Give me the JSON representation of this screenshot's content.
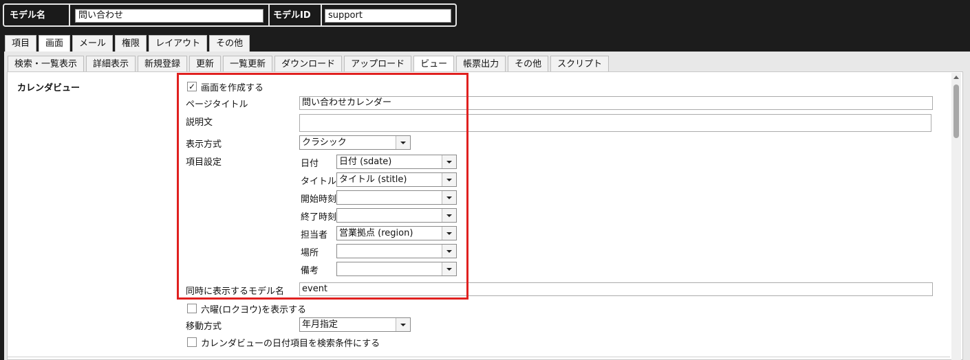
{
  "header": {
    "model_name_label": "モデル名",
    "model_name_value": "問い合わせ",
    "model_id_label": "モデルID",
    "model_id_value": "support"
  },
  "main_tabs": [
    "項目",
    "画面",
    "メール",
    "権限",
    "レイアウト",
    "その他"
  ],
  "sub_tabs": [
    "検索・一覧表示",
    "詳細表示",
    "新規登録",
    "更新",
    "一覧更新",
    "ダウンロード",
    "アップロード",
    "ビュー",
    "帳票出力",
    "その他",
    "スクリプト"
  ],
  "section": {
    "title": "カレンダビュー",
    "create_screen_label": "画面を作成する",
    "create_screen_checked": true,
    "page_title_label": "ページタイトル",
    "page_title_value": "問い合わせカレンダー",
    "description_label": "説明文",
    "description_value": "",
    "display_mode_label": "表示方式",
    "display_mode_value": "クラシック",
    "field_settings_label": "項目設定",
    "fields": [
      {
        "label": "日付",
        "value": "日付 (sdate)"
      },
      {
        "label": "タイトル",
        "value": "タイトル (stitle)"
      },
      {
        "label": "開始時刻",
        "value": ""
      },
      {
        "label": "終了時刻",
        "value": ""
      },
      {
        "label": "担当者",
        "value": "営業拠点 (region)"
      },
      {
        "label": "場所",
        "value": ""
      },
      {
        "label": "備考",
        "value": ""
      }
    ],
    "co_display_model_label": "同時に表示するモデル名",
    "co_display_model_value": "event",
    "rokuyo_label": "六曜(ロクヨウ)を表示する",
    "rokuyo_checked": false,
    "navigation_label": "移動方式",
    "navigation_value": "年月指定",
    "date_as_search_label": "カレンダビューの日付項目を検索条件にする",
    "date_as_search_checked": false
  },
  "colors": {
    "highlight": "#e0201f",
    "background": "#1c1c1c"
  }
}
